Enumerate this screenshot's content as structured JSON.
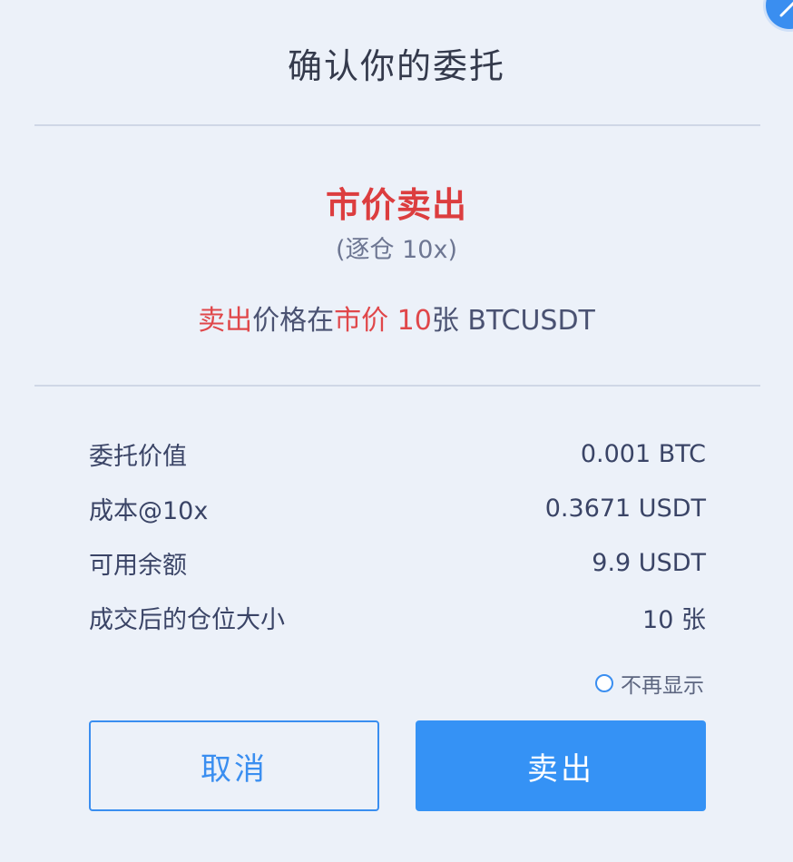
{
  "dialog": {
    "title": "确认你的委托",
    "order_type": "市价卖出",
    "margin_mode": "(逐仓 10x)",
    "summary": {
      "side": "卖出",
      "text_1": "价格在",
      "price_type": "市价",
      "qty": " 10",
      "text_2": "张 BTCUSDT"
    },
    "rows": [
      {
        "label": "委托价值",
        "value": "0.001 BTC"
      },
      {
        "label": "成本@10x",
        "value": "0.3671 USDT"
      },
      {
        "label": "可用余额",
        "value": "9.9 USDT"
      },
      {
        "label": "成交后的仓位大小",
        "value": "10 张"
      }
    ],
    "no_show_label": "不再显示",
    "cancel_label": "取消",
    "sell_label": "卖出"
  },
  "colors": {
    "accent": "#3592f5",
    "sell_red": "#dc3d3f",
    "background": "#ecf1f9"
  },
  "icons": {
    "corner": "close-icon"
  }
}
